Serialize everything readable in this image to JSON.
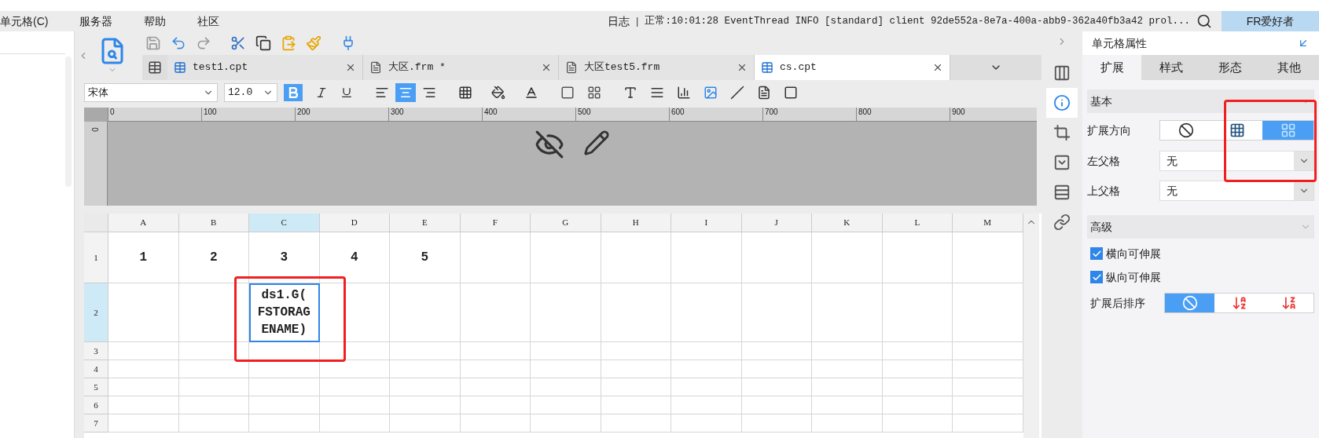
{
  "menu": [
    "单元格(C)",
    "服务器",
    "帮助",
    "社区"
  ],
  "log": {
    "label": "日志",
    "separator": "|",
    "text": "正常:10:01:28 EventThread INFO [standard] client 92de552a-8e7a-400a-abb9-362a40fb3a42 prol..."
  },
  "user_button": "FR爱好者",
  "file_tabs": [
    {
      "label": "test1.cpt",
      "kind": "cpt",
      "selected": false
    },
    {
      "label": "大区.frm *",
      "kind": "frm",
      "selected": false
    },
    {
      "label": "大区test5.frm",
      "kind": "frm",
      "selected": false
    },
    {
      "label": "cs.cpt",
      "kind": "cpt",
      "selected": true
    }
  ],
  "format_bar": {
    "font": "宋体",
    "size": "12.0",
    "bold": true,
    "align_options": [
      {
        "kind": "left",
        "selected": false
      },
      {
        "kind": "center",
        "selected": true
      },
      {
        "kind": "right",
        "selected": false
      }
    ]
  },
  "ruler": {
    "ticks": [
      "0",
      "100",
      "200",
      "300",
      "400",
      "500",
      "600",
      "700",
      "800",
      "900"
    ],
    "vertical": "0"
  },
  "grid": {
    "columns": [
      {
        "label": "A",
        "selected": false
      },
      {
        "label": "B",
        "selected": false
      },
      {
        "label": "C",
        "selected": true
      },
      {
        "label": "D",
        "selected": false
      },
      {
        "label": "E",
        "selected": false
      },
      {
        "label": "F",
        "selected": false
      },
      {
        "label": "G",
        "selected": false
      },
      {
        "label": "H",
        "selected": false
      },
      {
        "label": "I",
        "selected": false
      },
      {
        "label": "J",
        "selected": false
      },
      {
        "label": "K",
        "selected": false
      },
      {
        "label": "L",
        "selected": false
      },
      {
        "label": "M",
        "selected": false
      }
    ],
    "rows": [
      {
        "label": "1",
        "selected": false,
        "cells": [
          {
            "lines": [
              "1"
            ]
          },
          {
            "lines": [
              "2"
            ]
          },
          {
            "lines": [
              "3"
            ]
          },
          {
            "lines": [
              "4"
            ]
          },
          {
            "lines": [
              "5"
            ]
          }
        ]
      },
      {
        "label": "2",
        "selected": true,
        "cells": [
          {},
          {},
          {
            "lines": [
              "ds1.G(",
              "FSTORAG",
              "ENAME)"
            ],
            "selected": true
          }
        ]
      },
      {
        "label": "3",
        "selected": false,
        "cells": []
      },
      {
        "label": "4",
        "selected": false,
        "cells": []
      },
      {
        "label": "5",
        "selected": false,
        "cells": []
      },
      {
        "label": "6",
        "selected": false,
        "cells": []
      },
      {
        "label": "7",
        "selected": false,
        "cells": []
      }
    ]
  },
  "side_icons": [
    {
      "kind": "layout",
      "selected": false
    },
    {
      "kind": "cell",
      "selected": true
    },
    {
      "kind": "frame",
      "selected": false
    },
    {
      "kind": "widget",
      "selected": false
    },
    {
      "kind": "condition",
      "selected": false
    },
    {
      "kind": "link",
      "selected": false
    }
  ],
  "panel": {
    "title": "单元格属性",
    "tabs": [
      {
        "label": "扩展",
        "selected": true
      },
      {
        "label": "样式",
        "selected": false
      },
      {
        "label": "形态",
        "selected": false
      },
      {
        "label": "其他",
        "selected": false
      }
    ],
    "basic": {
      "title": "基本",
      "direction_label": "扩展方向",
      "direction_options": [
        {
          "kind": "none",
          "selected": false
        },
        {
          "kind": "vertical",
          "selected": false
        },
        {
          "kind": "horizontal",
          "selected": true
        }
      ],
      "left_parent": {
        "label": "左父格",
        "value": "无"
      },
      "top_parent": {
        "label": "上父格",
        "value": "无"
      }
    },
    "advanced": {
      "title": "高级",
      "checkboxes": [
        {
          "label": "横向可伸展",
          "checked": true
        },
        {
          "label": "纵向可伸展",
          "checked": true
        }
      ],
      "sort_label": "扩展后排序",
      "sort_options": [
        {
          "kind": "none",
          "selected": true
        },
        {
          "kind": "asc",
          "selected": false
        },
        {
          "kind": "desc",
          "selected": false
        }
      ]
    }
  }
}
